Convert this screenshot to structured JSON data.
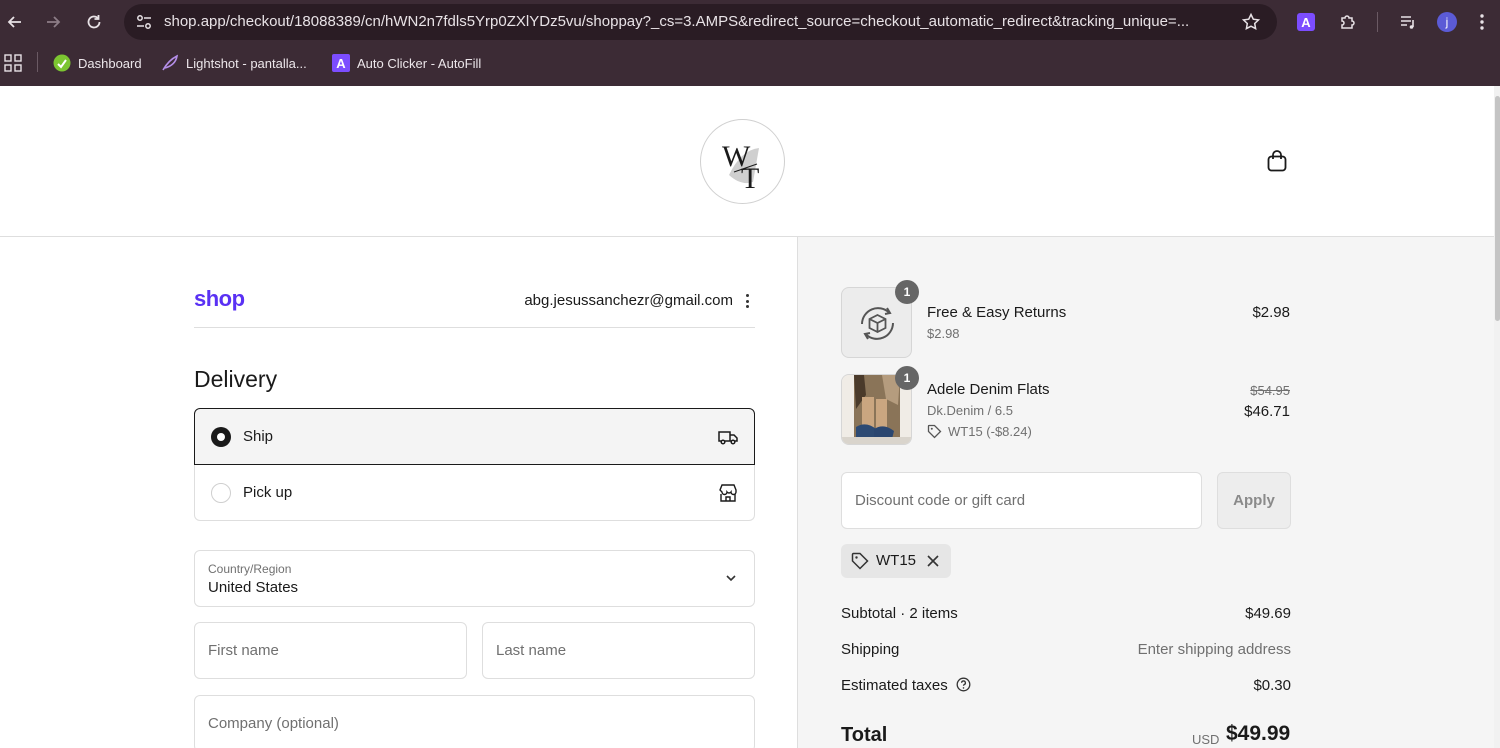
{
  "browser": {
    "url": "shop.app/checkout/18088389/cn/hWN2n7fdls5Yrp0ZXlYDz5vu/shoppay?_cs=3.AMPS&redirect_source=checkout_automatic_redirect&tracking_unique=...",
    "avatar_letter": "j",
    "extension_letter": "A",
    "bookmarks": [
      {
        "label": "Dashboard"
      },
      {
        "label": "Lightshot - pantalla..."
      },
      {
        "label": "Auto Clicker - AutoFill"
      }
    ]
  },
  "store": {
    "logo_text": "WT"
  },
  "checkout": {
    "shop_brand": "shop",
    "email": "abg.jesussanchezr@gmail.com",
    "delivery_title": "Delivery",
    "options": [
      {
        "label": "Ship",
        "selected": true
      },
      {
        "label": "Pick up",
        "selected": false
      }
    ],
    "country_label": "Country/Region",
    "country_value": "United States",
    "first_name_placeholder": "First name",
    "last_name_placeholder": "Last name",
    "company_placeholder": "Company (optional)"
  },
  "summary": {
    "items": [
      {
        "qty": "1",
        "name": "Free & Easy Returns",
        "sub": "$2.98",
        "price": "$2.98"
      },
      {
        "qty": "1",
        "name": "Adele Denim Flats",
        "sub": "Dk.Denim / 6.5",
        "discount": "WT15 (-$8.24)",
        "original_price": "$54.95",
        "price": "$46.71"
      }
    ],
    "discount_placeholder": "Discount code or gift card",
    "apply_label": "Apply",
    "applied_code": "WT15",
    "subtotal_label": "Subtotal · 2 items",
    "subtotal_value": "$49.69",
    "shipping_label": "Shipping",
    "shipping_value": "Enter shipping address",
    "taxes_label": "Estimated taxes",
    "taxes_value": "$0.30",
    "total_label": "Total",
    "currency": "USD",
    "total_value": "$49.99"
  },
  "colors": {
    "shop_purple": "#5a31f4",
    "chrome_bg": "#3c2b35"
  }
}
